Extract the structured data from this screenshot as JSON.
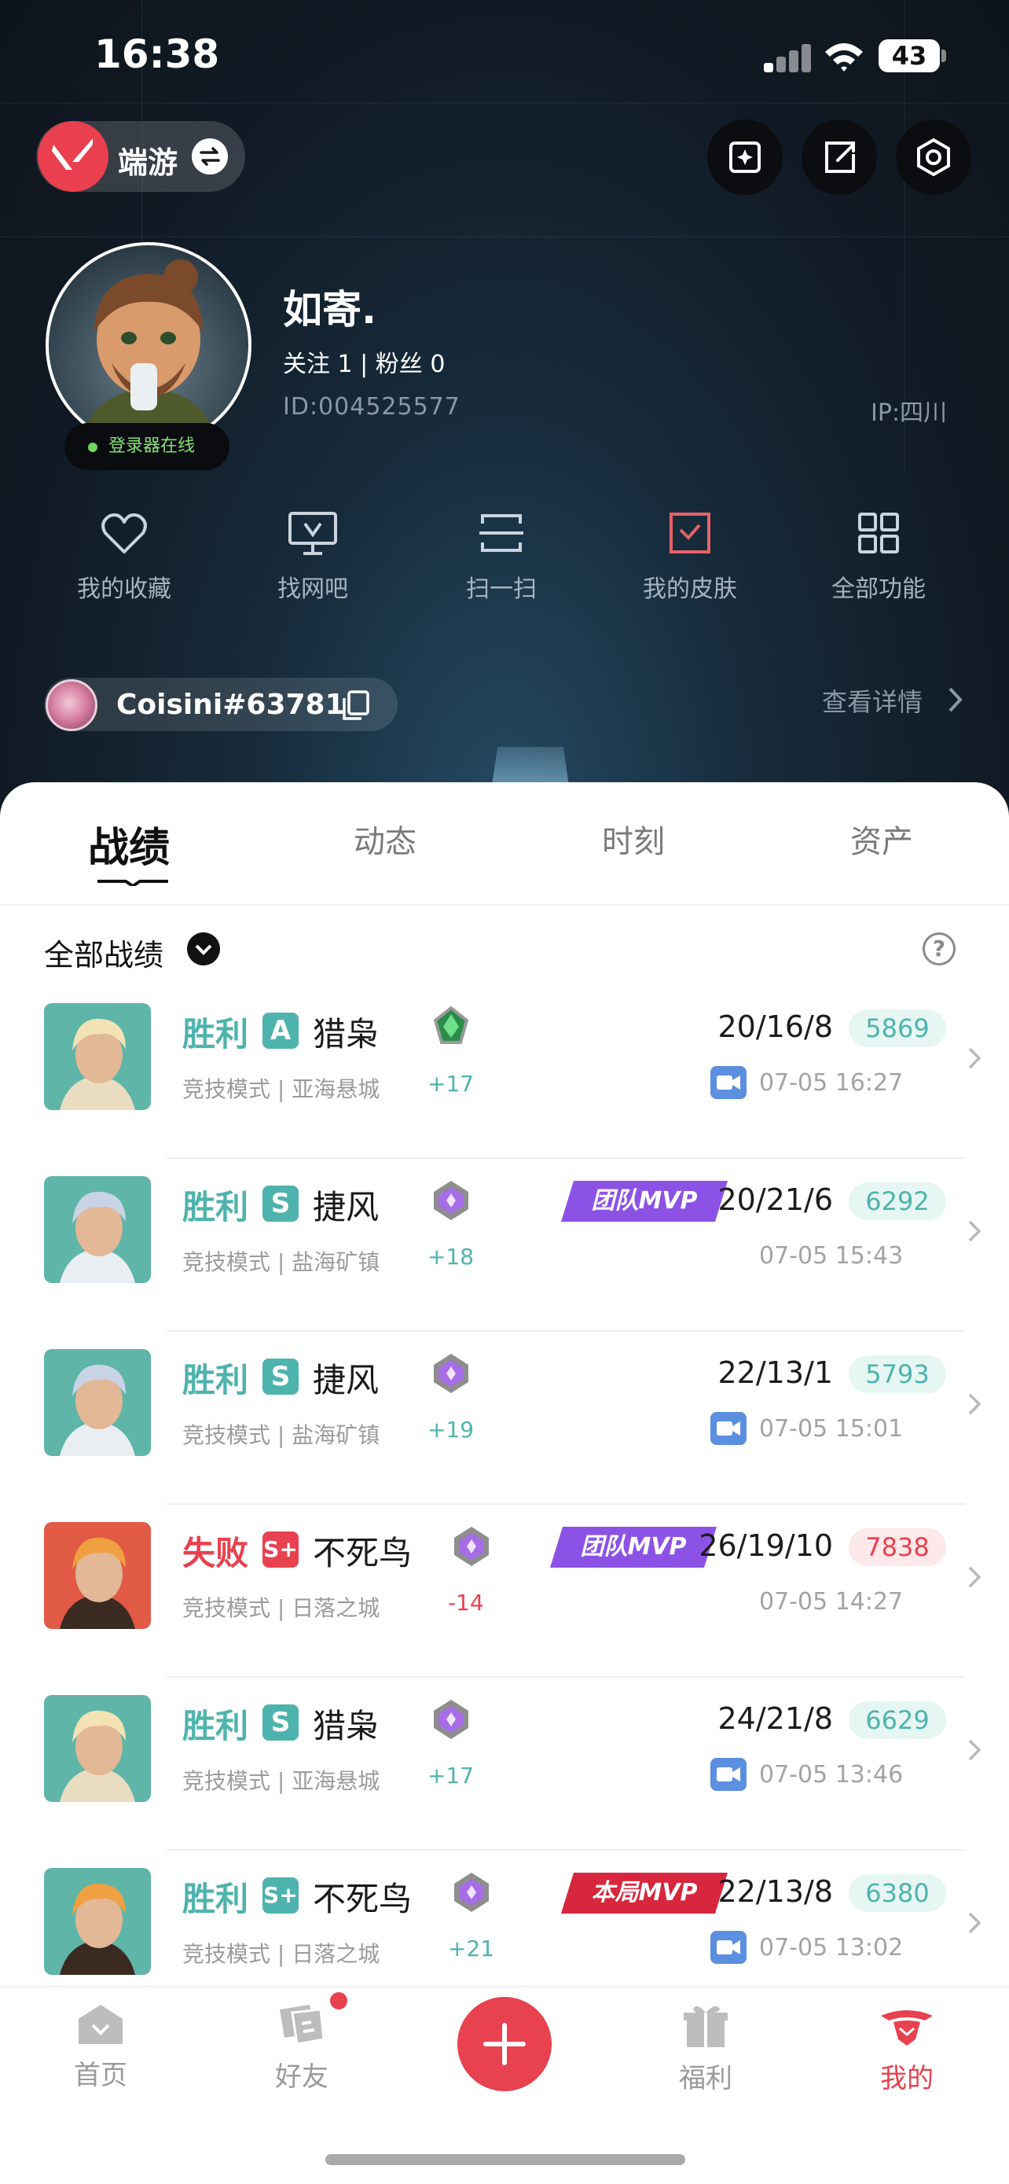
{
  "status_bar": {
    "time": "16:38",
    "battery": "43"
  },
  "header": {
    "game_name": "端游",
    "nickname": "如寄.",
    "follow_text": "关注 1    |    粉丝 0",
    "id_text": "ID:004525577",
    "ip_text": "IP:四川",
    "online_text": "登录器在线",
    "account_name": "Coisini#63781",
    "detail_link": "查看详情",
    "functions": [
      {
        "label": "我的收藏",
        "icon": "heart-icon"
      },
      {
        "label": "找网吧",
        "icon": "monitor-icon"
      },
      {
        "label": "扫一扫",
        "icon": "scan-icon"
      },
      {
        "label": "我的皮肤",
        "icon": "skin-icon"
      },
      {
        "label": "全部功能",
        "icon": "grid-icon"
      }
    ]
  },
  "tabs": [
    {
      "label": "战绩",
      "active": true
    },
    {
      "label": "动态",
      "active": false
    },
    {
      "label": "时刻",
      "active": false
    },
    {
      "label": "资产",
      "active": false
    }
  ],
  "filter": {
    "label": "全部战绩",
    "help": "?"
  },
  "matches": [
    {
      "result": "胜利",
      "win": true,
      "grade": "A",
      "agent": "猎枭",
      "mode": "竞技模式 | 亚海悬城",
      "delta": "+17",
      "kda": "20/16/8",
      "score": "5869",
      "time": "07-05 16:27",
      "video": true,
      "mvp": ""
    },
    {
      "result": "胜利",
      "win": true,
      "grade": "S",
      "agent": "捷风",
      "mode": "竞技模式 | 盐海矿镇",
      "delta": "+18",
      "kda": "20/21/6",
      "score": "6292",
      "time": "07-05 15:43",
      "video": false,
      "mvp": "团队MVP"
    },
    {
      "result": "胜利",
      "win": true,
      "grade": "S",
      "agent": "捷风",
      "mode": "竞技模式 | 盐海矿镇",
      "delta": "+19",
      "kda": "22/13/1",
      "score": "5793",
      "time": "07-05 15:01",
      "video": true,
      "mvp": ""
    },
    {
      "result": "失败",
      "win": false,
      "grade": "S+",
      "agent": "不死鸟",
      "mode": "竞技模式 | 日落之城",
      "delta": "-14",
      "kda": "26/19/10",
      "score": "7838",
      "time": "07-05 14:27",
      "video": false,
      "mvp": "团队MVP"
    },
    {
      "result": "胜利",
      "win": true,
      "grade": "S",
      "agent": "猎枭",
      "mode": "竞技模式 | 亚海悬城",
      "delta": "+17",
      "kda": "24/21/8",
      "score": "6629",
      "time": "07-05 13:46",
      "video": true,
      "mvp": ""
    },
    {
      "result": "胜利",
      "win": true,
      "grade": "S+",
      "agent": "不死鸟",
      "mode": "竞技模式 | 日落之城",
      "delta": "+21",
      "kda": "22/13/8",
      "score": "6380",
      "time": "07-05 13:02",
      "video": true,
      "mvp": "本局MVP"
    }
  ],
  "nav": [
    {
      "label": "首页",
      "active": false
    },
    {
      "label": "好友",
      "active": false
    },
    {
      "label": "福利",
      "active": false
    },
    {
      "label": "我的",
      "active": true
    }
  ],
  "colors": {
    "win": "#4fb3ad",
    "loss": "#e8414f",
    "accent": "#e8414f",
    "mvp_team": "#8c52e6",
    "mvp_match": "#d7263d"
  }
}
